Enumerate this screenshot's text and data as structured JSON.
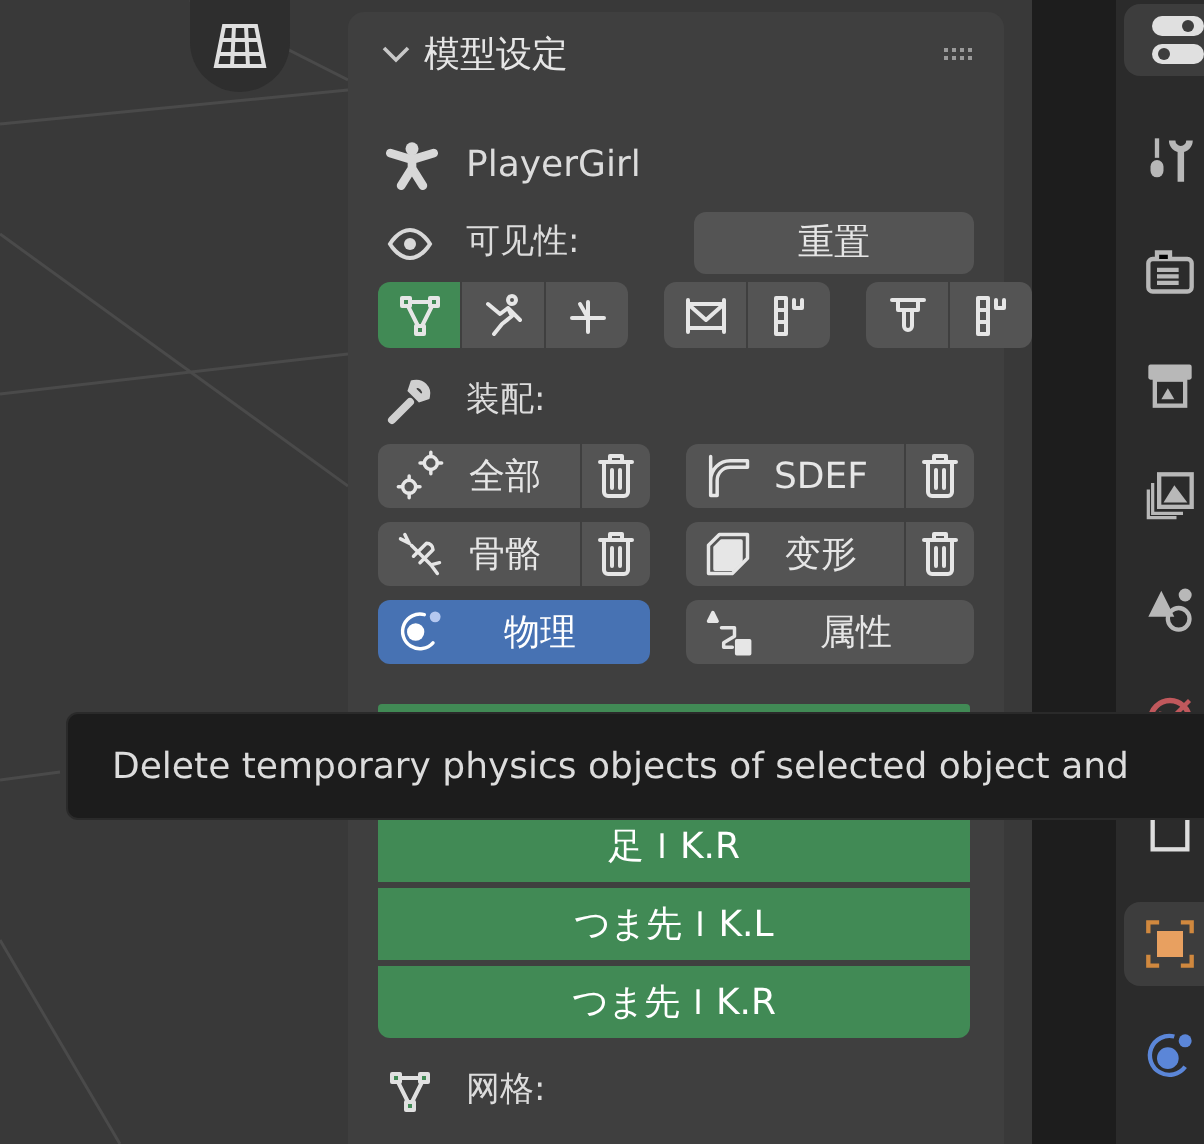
{
  "panel": {
    "title": "模型设定",
    "object_name": "PlayerGirl",
    "visibility": {
      "label": "可见性:",
      "reset_button": "重置",
      "groups": [
        [
          {
            "kind": "mesh",
            "selected": true
          },
          {
            "kind": "armature",
            "selected": false
          },
          {
            "kind": "axes",
            "selected": false
          }
        ],
        [
          {
            "kind": "cage",
            "selected": false
          },
          {
            "kind": "dots",
            "selected": false
          }
        ],
        [
          {
            "kind": "hook",
            "selected": false
          },
          {
            "kind": "dots",
            "selected": false
          }
        ]
      ]
    },
    "rigging": {
      "label": "装配:",
      "buttons": [
        {
          "kind": "gears",
          "label": "全部",
          "delete": true,
          "selected": false
        },
        {
          "kind": "sdef",
          "label": "SDEF",
          "delete": true,
          "selected": false
        },
        {
          "kind": "bone",
          "label": "骨骼",
          "delete": true,
          "selected": false
        },
        {
          "kind": "shape",
          "label": "变形",
          "delete": true,
          "selected": false
        },
        {
          "kind": "physics",
          "label": "物理",
          "delete": false,
          "selected": true
        },
        {
          "kind": "driver",
          "label": "属性",
          "delete": false,
          "selected": false
        }
      ]
    },
    "bone_buttons": [
      "足ＩK.R",
      "つま先ＩK.L",
      "つま先ＩK.R"
    ],
    "mesh_label": "网格:"
  },
  "tooltip": {
    "text": "Delete temporary physics objects of selected object and"
  },
  "properties_tabs": [
    {
      "kind": "tool",
      "selected": false
    },
    {
      "kind": "render",
      "selected": false
    },
    {
      "kind": "output",
      "selected": false
    },
    {
      "kind": "view",
      "selected": false
    },
    {
      "kind": "scene",
      "selected": false
    },
    {
      "kind": "world",
      "selected": false
    },
    {
      "kind": "collection",
      "selected": false
    },
    {
      "kind": "object",
      "selected": true
    },
    {
      "kind": "physics",
      "selected": false
    }
  ]
}
